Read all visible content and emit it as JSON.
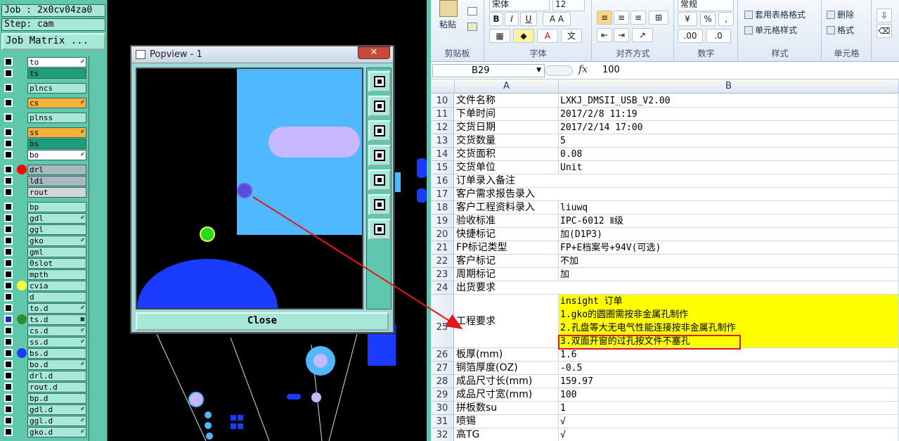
{
  "cam": {
    "job": "Job : 2x0cv04za0",
    "step": "Step: cam",
    "matrix_button": "Job Matrix ...",
    "layers": [
      {
        "name": "to",
        "bg": "#ffffff",
        "mark": "✐",
        "dot": ""
      },
      {
        "name": "ts",
        "bg": "#1f9d7a",
        "mark": "",
        "dot": ""
      },
      {
        "name": "plncs",
        "bg": "#a8e8d8",
        "mark": "",
        "dot": "",
        "gap": true
      },
      {
        "name": "cs",
        "bg": "#f7b13c",
        "mark": "✐",
        "dot": "",
        "gap": true
      },
      {
        "name": "plnss",
        "bg": "#a8e8d8",
        "mark": "",
        "dot": "",
        "gap": true
      },
      {
        "name": "ss",
        "bg": "#f7b13c",
        "mark": "✐",
        "dot": "",
        "gap": true
      },
      {
        "name": "bs",
        "bg": "#1f9d7a",
        "mark": "",
        "dot": ""
      },
      {
        "name": "bo",
        "bg": "#ffffff",
        "mark": "✐",
        "dot": ""
      },
      {
        "name": "drl",
        "bg": "#a9b8c0",
        "mark": "",
        "dot": "#ff0000",
        "gap": true
      },
      {
        "name": "ldi",
        "bg": "#a9b8c0",
        "mark": "",
        "dot": ""
      },
      {
        "name": "rout",
        "bg": "#d6d6d6",
        "mark": "",
        "dot": ""
      },
      {
        "name": "bp",
        "bg": "#a8e8d8",
        "mark": "",
        "dot": "",
        "gap": true
      },
      {
        "name": "gdl",
        "bg": "#a8e8d8",
        "mark": "✐",
        "dot": ""
      },
      {
        "name": "ggl",
        "bg": "#a8e8d8",
        "mark": "",
        "dot": ""
      },
      {
        "name": "gko",
        "bg": "#a8e8d8",
        "mark": "✐",
        "dot": ""
      },
      {
        "name": "gml",
        "bg": "#a8e8d8",
        "mark": "",
        "dot": ""
      },
      {
        "name": "0slot",
        "bg": "#a8e8d8",
        "mark": "",
        "dot": ""
      },
      {
        "name": "mpth",
        "bg": "#a8e8d8",
        "mark": "",
        "dot": ""
      },
      {
        "name": "cvia",
        "bg": "#a8e8d8",
        "mark": "",
        "dot": "#ffff33"
      },
      {
        "name": "d",
        "bg": "#a8e8d8",
        "mark": "",
        "dot": ""
      },
      {
        "name": "to.d",
        "bg": "#a8e8d8",
        "mark": "✐",
        "dot": ""
      },
      {
        "name": "ts.d",
        "bg": "#a8e8d8",
        "mark": "▦",
        "dot": "#2e8b2e",
        "active": true
      },
      {
        "name": "cs.d",
        "bg": "#a8e8d8",
        "mark": "✐",
        "dot": ""
      },
      {
        "name": "ss.d",
        "bg": "#a8e8d8",
        "mark": "✐",
        "dot": ""
      },
      {
        "name": "bs.d",
        "bg": "#a8e8d8",
        "mark": "",
        "dot": "#1a3cff"
      },
      {
        "name": "bo.d",
        "bg": "#a8e8d8",
        "mark": "✐",
        "dot": ""
      },
      {
        "name": "drl.d",
        "bg": "#a8e8d8",
        "mark": "",
        "dot": ""
      },
      {
        "name": "rout.d",
        "bg": "#a8e8d8",
        "mark": "",
        "dot": ""
      },
      {
        "name": "bp.d",
        "bg": "#a8e8d8",
        "mark": "",
        "dot": ""
      },
      {
        "name": "gdl.d",
        "bg": "#a8e8d8",
        "mark": "✐",
        "dot": ""
      },
      {
        "name": "ggl.d",
        "bg": "#a8e8d8",
        "mark": "✐",
        "dot": ""
      },
      {
        "name": "gko.d",
        "bg": "#a8e8d8",
        "mark": "✐",
        "dot": ""
      }
    ]
  },
  "popview": {
    "title": "Popview - 1",
    "close_x": "✕",
    "close_button": "Close",
    "tools": [
      "zoom-window-icon",
      "pan-up-icon",
      "pan-down-icon",
      "pan-left-icon",
      "pan-right-icon",
      "zoom-fit-icon",
      "zoom-home-icon"
    ]
  },
  "excel": {
    "ribbon": {
      "paste": "粘贴",
      "clipboard_label": "剪贴板",
      "font_name": "宋体",
      "font_size": "12",
      "font_label": "字体",
      "align_label": "对齐方式",
      "number_format": "常规",
      "number_label": "数字",
      "table_format": "套用表格格式",
      "cell_style": "单元格样式",
      "style_label": "样式",
      "delete": "删除",
      "format": "格式",
      "cells_label": "单元格",
      "bold": "B",
      "italic": "I",
      "underline": "U",
      "percent": "%"
    },
    "namebox": "B29",
    "formula": "100",
    "fx": "fx",
    "col_a": "A",
    "col_b": "B",
    "rows": [
      {
        "n": "10",
        "a": "文件名称",
        "b": "LXKJ_DMSII_USB_V2.00"
      },
      {
        "n": "11",
        "a": "下单时间",
        "b": "2017/2/8 11:19"
      },
      {
        "n": "12",
        "a": "交货日期",
        "b": "2017/2/14 17:00"
      },
      {
        "n": "13",
        "a": "交货数量",
        "b": "5"
      },
      {
        "n": "14",
        "a": "交货面积",
        "b": "0.08"
      },
      {
        "n": "15",
        "a": "交货单位",
        "b": "Unit"
      },
      {
        "n": "16",
        "a": "订单录入备注",
        "b": "",
        "span": true
      },
      {
        "n": "17",
        "a": "客户需求报告录入",
        "b": "",
        "span": true
      },
      {
        "n": "18",
        "a": "客户工程资料录入",
        "b": "liuwq"
      },
      {
        "n": "19",
        "a": "验收标准",
        "b": "IPC-6012 Ⅱ级"
      },
      {
        "n": "20",
        "a": "快捷标记",
        "b": "加(D1P3)"
      },
      {
        "n": "21",
        "a": "FP标记类型",
        "b": "FP+E档案号+94V(可选)"
      },
      {
        "n": "22",
        "a": "客户标记",
        "b": "不加"
      },
      {
        "n": "23",
        "a": "周期标记",
        "b": "加"
      },
      {
        "n": "24",
        "a": "出货要求",
        "b": "",
        "span": true
      }
    ],
    "row25": {
      "n": "25",
      "a": "工程要求",
      "lines": [
        "insight 订单",
        "1.gko的圆圈需按非金属孔制作",
        "2.孔盘等大无电气性能连接按非金属孔制作",
        "3.双面开窗的过孔按文件不塞孔"
      ]
    },
    "rows_after": [
      {
        "n": "26",
        "a": "板厚(mm)",
        "b": "1.6"
      },
      {
        "n": "27",
        "a": "铜箔厚度(OZ)",
        "b": "-0.5"
      },
      {
        "n": "28",
        "a": "成品尺寸长(mm)",
        "b": "159.97"
      },
      {
        "n": "29",
        "a": "成品尺寸宽(mm)",
        "b": "100"
      },
      {
        "n": "30",
        "a": "拼板数su",
        "b": "1"
      },
      {
        "n": "31",
        "a": "喷锡",
        "b": "√"
      },
      {
        "n": "32",
        "a": "高TG",
        "b": "√"
      }
    ]
  }
}
